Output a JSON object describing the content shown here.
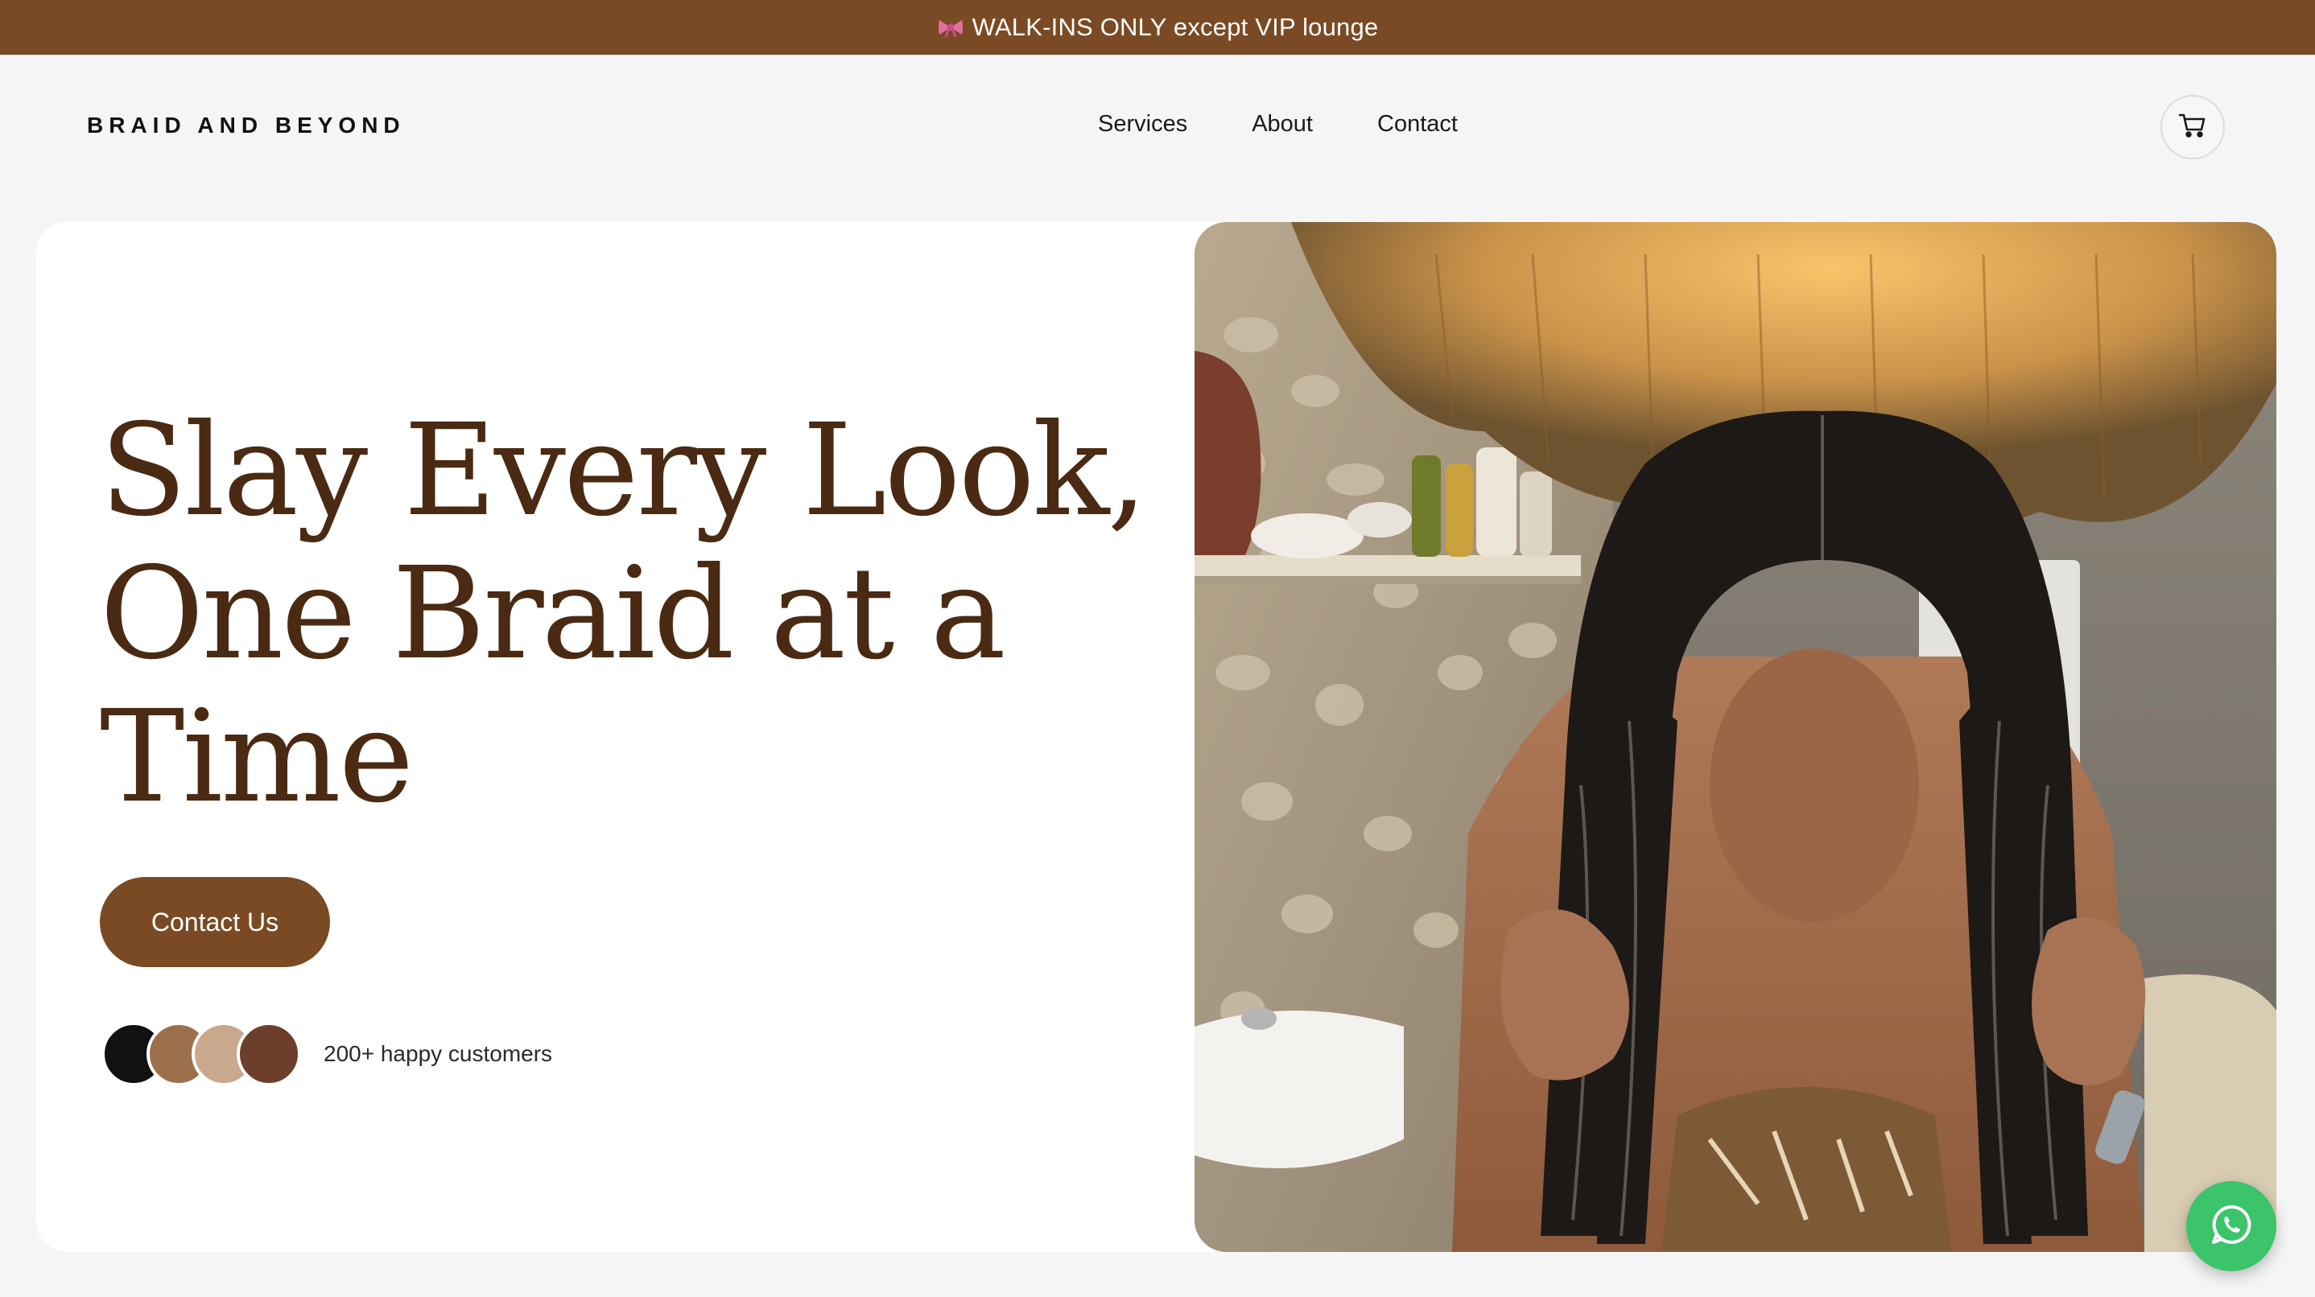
{
  "announcement": {
    "icon": "ribbon-bow-icon",
    "text": "WALK-INS ONLY except VIP lounge"
  },
  "header": {
    "brand": "BRAID AND BEYOND",
    "nav": [
      "Services",
      "About",
      "Contact"
    ],
    "cart_icon": "shopping-cart-icon"
  },
  "hero": {
    "headline_lines": [
      "Slay Every Look,",
      "One Braid at a",
      "Time"
    ],
    "cta_label": "Contact Us",
    "social_proof": "200+ happy customers",
    "swatch_colors": [
      "#111111",
      "#9c6f4d",
      "#c9a88d",
      "#6b3f2a"
    ],
    "image_icon": "salon-hero-photo"
  },
  "chat_icon": "whatsapp-icon",
  "colors": {
    "brand_brown": "#7a4a24",
    "headline": "#4a2a12",
    "whatsapp_green": "#3cc46a"
  }
}
